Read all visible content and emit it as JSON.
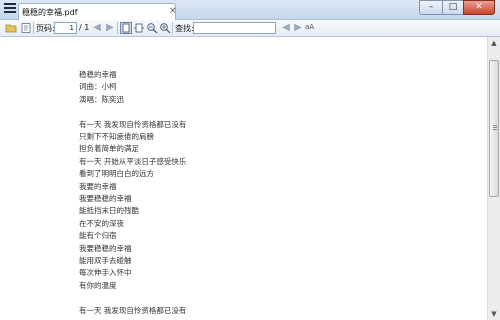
{
  "window": {
    "tab_title": "稳稳的幸福.pdf",
    "tab_close": "×",
    "minimize": "–",
    "maximize": "□",
    "close": "✕"
  },
  "toolbar": {
    "page_label": "页码:",
    "page_value": "1",
    "page_total": "/ 1",
    "find_label": "查找:",
    "find_value": "",
    "match_case_label": "aA"
  },
  "icons": {
    "menu": "menu-icon",
    "open": "folder-open-icon",
    "bookmarks": "bookmarks-icon",
    "prev_page": "arrow-left-icon",
    "next_page": "arrow-right-icon",
    "fit_page": "fit-page-icon",
    "fit_width": "fit-width-icon",
    "zoom_out": "zoom-out-icon",
    "zoom_in": "zoom-in-icon",
    "find_prev": "find-previous-icon",
    "find_next": "find-next-icon"
  },
  "document": {
    "lines": [
      "稳稳的幸福",
      "词曲：小柯",
      "演唱：陈奕迅",
      "",
      "有一天 我发现自怜资格都已没有",
      "只剩下不知疲倦的肩膀",
      "担负着简单的满足",
      "有一天 开始从平淡日子感受快乐",
      "看到了明明白白的远方",
      "我要的幸福",
      "我要稳稳的幸福",
      "能抵挡末日的残酷",
      "在不安的深夜",
      "能有个归宿",
      "我要稳稳的幸福",
      "能用双手去碰触",
      "每次伸手入怀中",
      "有你的温度",
      "",
      "有一天 我发现自怜资格都已没有"
    ]
  },
  "colors": {
    "titlebar": "#c6d8ee",
    "close_button": "#c9432c",
    "page_background": "#ffffff",
    "text": "#333333"
  }
}
